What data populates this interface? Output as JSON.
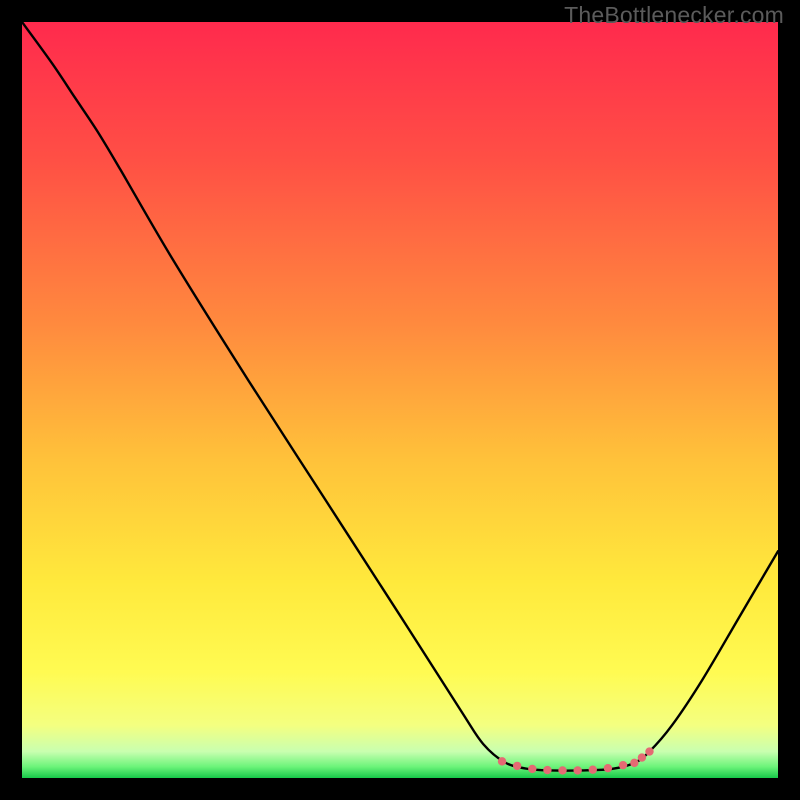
{
  "watermark": "TheBottlenecker.com",
  "chart_data": {
    "type": "line",
    "title": "",
    "xlabel": "",
    "ylabel": "",
    "xlim": [
      0,
      100
    ],
    "ylim": [
      0,
      100
    ],
    "gradient_stops": [
      {
        "offset": 0.0,
        "color": "#ff2a4d"
      },
      {
        "offset": 0.18,
        "color": "#ff4f45"
      },
      {
        "offset": 0.4,
        "color": "#ff8a3e"
      },
      {
        "offset": 0.58,
        "color": "#ffc23a"
      },
      {
        "offset": 0.74,
        "color": "#ffe93c"
      },
      {
        "offset": 0.86,
        "color": "#fffb52"
      },
      {
        "offset": 0.93,
        "color": "#f4ff80"
      },
      {
        "offset": 0.965,
        "color": "#c9ffb0"
      },
      {
        "offset": 0.985,
        "color": "#6cf47a"
      },
      {
        "offset": 1.0,
        "color": "#17c84a"
      }
    ],
    "series": [
      {
        "name": "curve",
        "color": "#000000",
        "width": 2.4,
        "points": [
          {
            "x": 0.0,
            "y": 100.0
          },
          {
            "x": 4.0,
            "y": 94.5
          },
          {
            "x": 7.0,
            "y": 90.0
          },
          {
            "x": 10.0,
            "y": 85.5
          },
          {
            "x": 13.0,
            "y": 80.5
          },
          {
            "x": 20.0,
            "y": 68.5
          },
          {
            "x": 30.0,
            "y": 52.5
          },
          {
            "x": 40.0,
            "y": 37.0
          },
          {
            "x": 50.0,
            "y": 21.5
          },
          {
            "x": 58.0,
            "y": 9.0
          },
          {
            "x": 61.0,
            "y": 4.5
          },
          {
            "x": 64.0,
            "y": 2.0
          },
          {
            "x": 67.0,
            "y": 1.2
          },
          {
            "x": 70.0,
            "y": 1.0
          },
          {
            "x": 74.0,
            "y": 1.0
          },
          {
            "x": 78.0,
            "y": 1.2
          },
          {
            "x": 81.0,
            "y": 2.0
          },
          {
            "x": 83.0,
            "y": 3.5
          },
          {
            "x": 86.0,
            "y": 7.0
          },
          {
            "x": 90.0,
            "y": 13.0
          },
          {
            "x": 95.0,
            "y": 21.5
          },
          {
            "x": 100.0,
            "y": 30.0
          }
        ]
      }
    ],
    "highlight": {
      "color": "#e46a73",
      "radius": 4.2,
      "points": [
        {
          "x": 63.5,
          "y": 2.2
        },
        {
          "x": 65.5,
          "y": 1.6
        },
        {
          "x": 67.5,
          "y": 1.2
        },
        {
          "x": 69.5,
          "y": 1.05
        },
        {
          "x": 71.5,
          "y": 1.0
        },
        {
          "x": 73.5,
          "y": 1.0
        },
        {
          "x": 75.5,
          "y": 1.1
        },
        {
          "x": 77.5,
          "y": 1.3
        },
        {
          "x": 79.5,
          "y": 1.7
        },
        {
          "x": 81.0,
          "y": 2.0
        },
        {
          "x": 82.0,
          "y": 2.7
        },
        {
          "x": 83.0,
          "y": 3.5
        }
      ]
    }
  }
}
